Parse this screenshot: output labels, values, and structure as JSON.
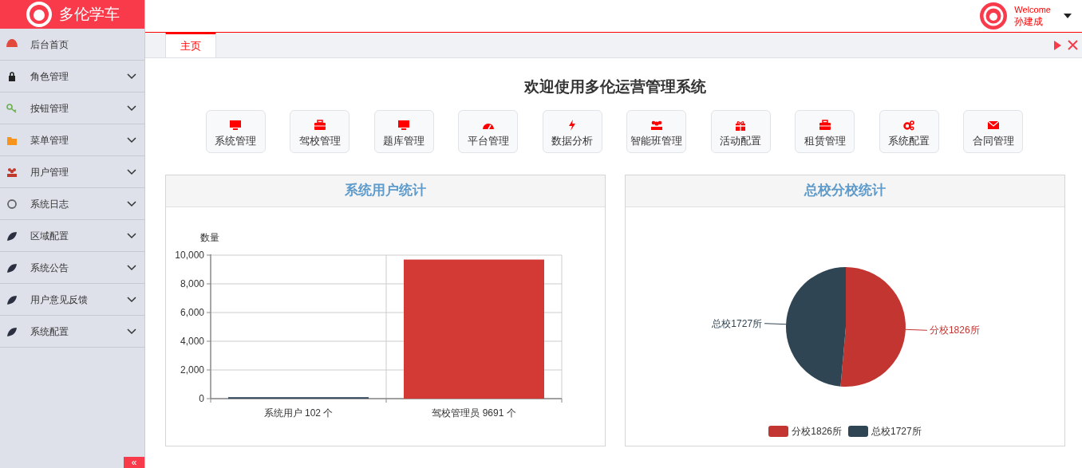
{
  "brand": {
    "name": "多伦学车"
  },
  "user": {
    "greeting": "Welcome",
    "name": "孙建成"
  },
  "sidebar": {
    "items": [
      {
        "label": "后台首页"
      },
      {
        "label": "角色管理",
        "expanded": false
      },
      {
        "label": "按钮管理",
        "expanded": false
      },
      {
        "label": "菜单管理",
        "expanded": false
      },
      {
        "label": "用户管理",
        "expanded": false
      },
      {
        "label": "系统日志",
        "expanded": false
      },
      {
        "label": "区域配置",
        "expanded": false
      },
      {
        "label": "系统公告",
        "expanded": false
      },
      {
        "label": "用户意见反馈",
        "expanded": false
      },
      {
        "label": "系统配置",
        "expanded": false
      }
    ],
    "collapse_button": "«"
  },
  "tabs": [
    {
      "label": "主页",
      "selected": true
    }
  ],
  "page": {
    "title": "欢迎使用多伦运营管理系统",
    "shortcuts": [
      "系统管理",
      "驾校管理",
      "题库管理",
      "平台管理",
      "数据分析",
      "智能班管理",
      "活动配置",
      "租赁管理",
      "系统配置",
      "合同管理"
    ],
    "panels": [
      {
        "title": "系统用户统计",
        "chart_data": {
          "type": "bar",
          "ylabel": "数量",
          "categories": [
            "系统用户 102 个",
            "驾校管理员 9691 个"
          ],
          "values": [
            102,
            9691
          ],
          "colors": [
            "#34495e",
            "#d43a35"
          ],
          "ylim": [
            0,
            10000
          ],
          "grid": true,
          "yticks": [
            {
              "value": 0,
              "label": "0"
            },
            {
              "value": 2000,
              "label": "2,000"
            },
            {
              "value": 4000,
              "label": "4,000"
            },
            {
              "value": 6000,
              "label": "6,000"
            },
            {
              "value": 8000,
              "label": "8,000"
            },
            {
              "value": 10000,
              "label": "10,000"
            }
          ]
        }
      },
      {
        "title": "总校分校统计",
        "chart_data": {
          "type": "pie",
          "categories": [
            "分校1826所",
            "总校1727所"
          ],
          "values": [
            1826,
            1727
          ],
          "colors": [
            "#c23531",
            "#2f4554"
          ]
        },
        "legend": [
          {
            "label": "分校1826所",
            "color": "#c23531"
          },
          {
            "label": "总校1727所",
            "color": "#2f4554"
          }
        ]
      }
    ]
  }
}
